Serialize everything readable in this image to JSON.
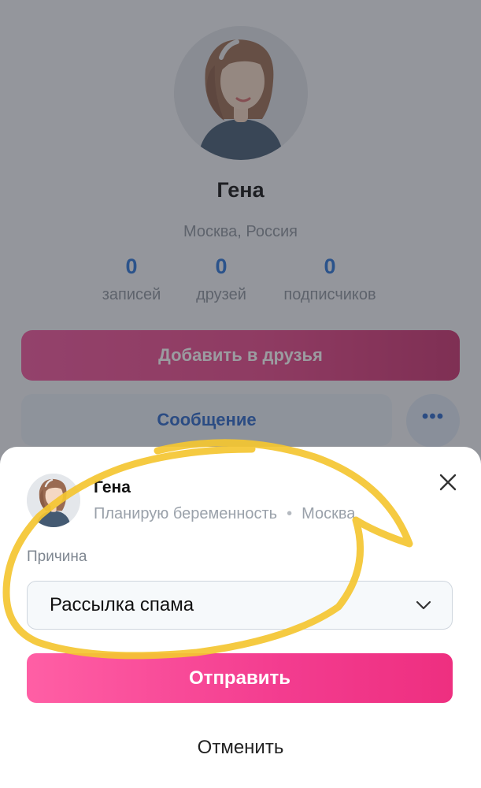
{
  "profile": {
    "name": "Гена",
    "location": "Москва, Россия",
    "stats": [
      {
        "value": "0",
        "label": "записей"
      },
      {
        "value": "0",
        "label": "друзей"
      },
      {
        "value": "0",
        "label": "подписчиков"
      }
    ],
    "add_friend_label": "Добавить в друзья",
    "message_label": "Сообщение",
    "more_label": "•••"
  },
  "sheet": {
    "name": "Гена",
    "status": "Планирую беременность",
    "separator": "•",
    "city": "Москва",
    "reason_label": "Причина",
    "reason_value": "Рассылка спама",
    "submit_label": "Отправить",
    "cancel_label": "Отменить"
  },
  "icons": {
    "close": "close-icon",
    "chevron": "chevron-down-icon",
    "more": "more-dots-icon"
  },
  "colors": {
    "accent_pink": "#f0539a",
    "link_blue": "#2a73d6",
    "highlight_yellow": "#f4c531"
  }
}
